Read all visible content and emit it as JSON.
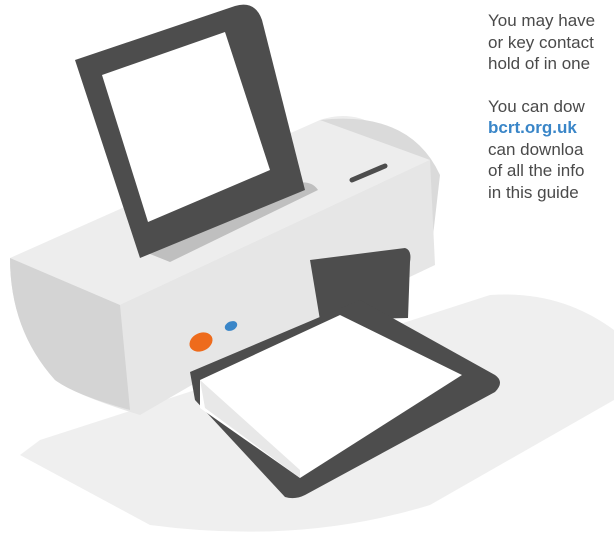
{
  "text": {
    "para1": [
      "You may have",
      "or key contact",
      "hold of in one"
    ],
    "para2_intro": "You can dow",
    "para2_link": "bcrt.org.uk",
    "para2_rest": [
      "can downloa",
      "of all the info",
      "in this guide"
    ]
  },
  "colors": {
    "text": "#4a4a4a",
    "link": "#3a86c8",
    "printer_body": "#e6e6e6",
    "printer_dark": "#4d4d4d",
    "shadow": "#efefef",
    "button_orange": "#ee6b1c",
    "button_blue": "#3a86c8"
  }
}
